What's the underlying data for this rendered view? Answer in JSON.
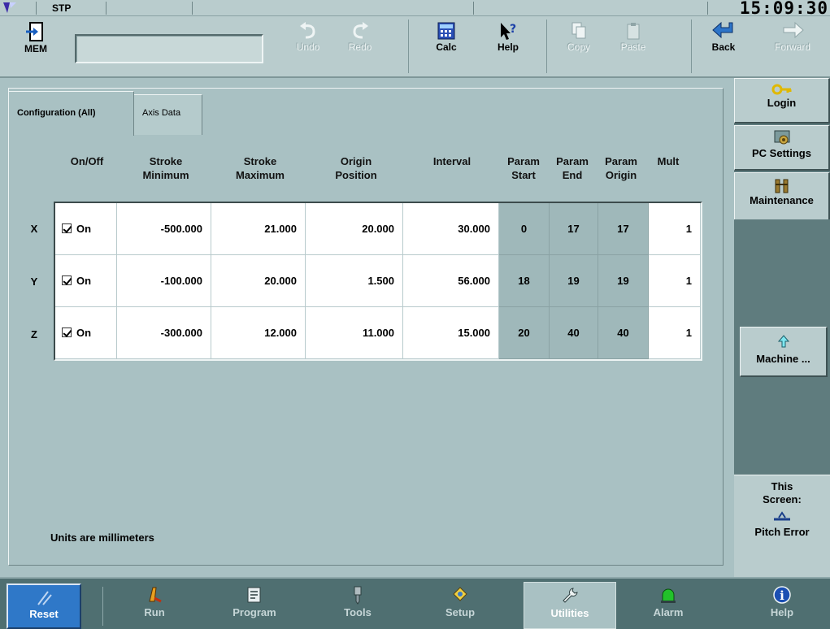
{
  "status": {
    "mode": "STP",
    "clock": "15:09:30"
  },
  "toolbar": {
    "mem_label": "MEM",
    "mem_display": "",
    "undo_label": "Undo",
    "redo_label": "Redo",
    "calc_label": "Calc",
    "help_label": "Help",
    "copy_label": "Copy",
    "paste_label": "Paste",
    "back_label": "Back",
    "forward_label": "Forward"
  },
  "tabs": [
    {
      "label": "Configuration (All)",
      "active": true
    },
    {
      "label": "Axis Data",
      "active": false
    }
  ],
  "columns": [
    {
      "line1": "On/Off",
      "line2": ""
    },
    {
      "line1": "Stroke",
      "line2": "Minimum"
    },
    {
      "line1": "Stroke",
      "line2": "Maximum"
    },
    {
      "line1": "Origin",
      "line2": "Position"
    },
    {
      "line1": "Interval",
      "line2": ""
    },
    {
      "line1": "Param",
      "line2": "Start"
    },
    {
      "line1": "Param",
      "line2": "End"
    },
    {
      "line1": "Param",
      "line2": "Origin"
    },
    {
      "line1": "Mult",
      "line2": ""
    }
  ],
  "rows": [
    {
      "axis": "X",
      "onoff": "On",
      "checked": true,
      "stroke_min": "-500.000",
      "stroke_max": "21.000",
      "origin": "20.000",
      "interval": "30.000",
      "param_start": "0",
      "param_end": "17",
      "param_origin": "17",
      "mult": "1"
    },
    {
      "axis": "Y",
      "onoff": "On",
      "checked": true,
      "stroke_min": "-100.000",
      "stroke_max": "20.000",
      "origin": "1.500",
      "interval": "56.000",
      "param_start": "18",
      "param_end": "19",
      "param_origin": "19",
      "mult": "1"
    },
    {
      "axis": "Z",
      "onoff": "On",
      "checked": true,
      "stroke_min": "-300.000",
      "stroke_max": "12.000",
      "origin": "11.000",
      "interval": "15.000",
      "param_start": "20",
      "param_end": "40",
      "param_origin": "40",
      "mult": "1"
    }
  ],
  "units_note": "Units are millimeters",
  "side": {
    "login": "Login",
    "pc_settings": "PC Settings",
    "maintenance": "Maintenance",
    "machine": "Machine ...",
    "this_screen_1": "This",
    "this_screen_2": "Screen:",
    "this_screen_name": "Pitch Error"
  },
  "nav": {
    "reset": "Reset",
    "run": "Run",
    "program": "Program",
    "tools": "Tools",
    "setup": "Setup",
    "utilities": "Utilities",
    "alarm": "Alarm",
    "help": "Help"
  },
  "colors": {
    "background": "#a9c1c3",
    "reset_blue": "#2f78c8",
    "alarm_green": "#22c22a",
    "help_blue": "#1b4fb3"
  }
}
